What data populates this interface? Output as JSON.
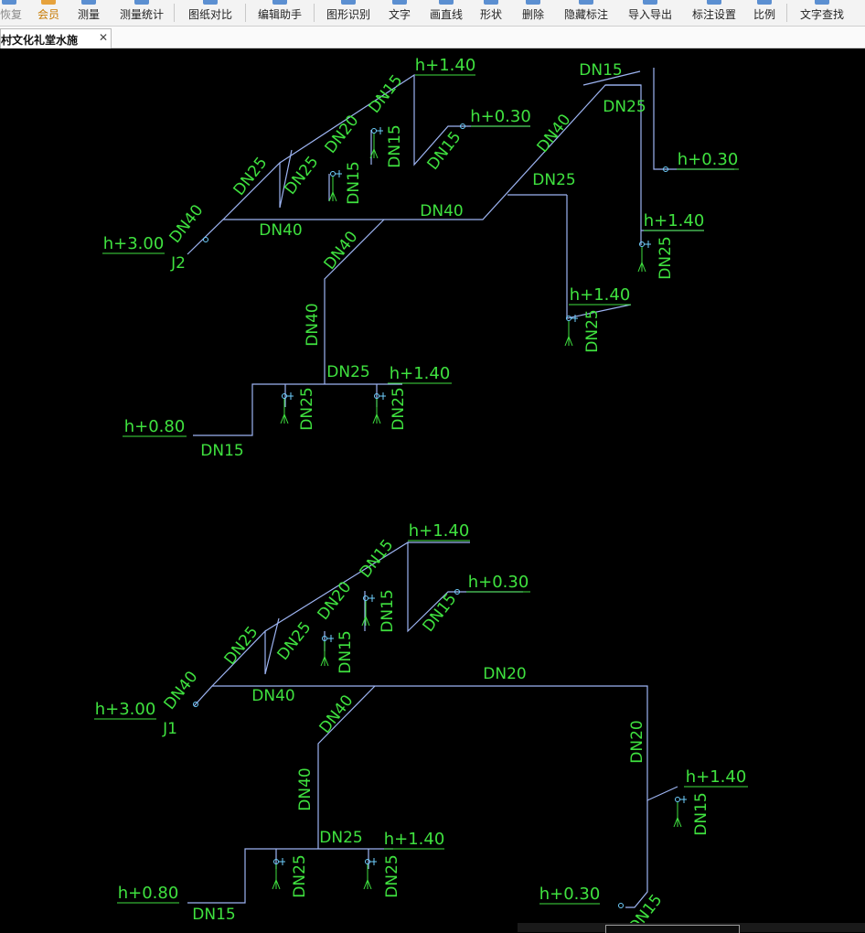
{
  "toolbar": {
    "items": [
      {
        "label": "恢复",
        "icon": "restore-icon",
        "enabled": false
      },
      {
        "label": "会员",
        "icon": "member-icon",
        "enabled": true
      },
      {
        "label": "测量",
        "icon": "measure-icon",
        "enabled": true
      },
      {
        "label": "测量统计",
        "icon": "measure-stats-icon",
        "enabled": true
      },
      {
        "label": "图纸对比",
        "icon": "compare-icon",
        "enabled": true
      },
      {
        "label": "编辑助手",
        "icon": "edit-assistant-icon",
        "enabled": true
      },
      {
        "label": "图形识别",
        "icon": "shape-recognition-icon",
        "enabled": true
      },
      {
        "label": "文字",
        "icon": "text-icon",
        "enabled": true
      },
      {
        "label": "画直线",
        "icon": "line-icon",
        "enabled": true
      },
      {
        "label": "形状",
        "icon": "shape-icon",
        "enabled": true
      },
      {
        "label": "删除",
        "icon": "delete-icon",
        "enabled": true
      },
      {
        "label": "隐藏标注",
        "icon": "hide-annotation-icon",
        "enabled": true
      },
      {
        "label": "导入导出",
        "icon": "import-export-icon",
        "enabled": true
      },
      {
        "label": "标注设置",
        "icon": "annotation-settings-icon",
        "enabled": true
      },
      {
        "label": "比例",
        "icon": "scale-icon",
        "enabled": true
      },
      {
        "label": "文字查找",
        "icon": "text-search-icon",
        "enabled": true
      }
    ]
  },
  "tab": {
    "title": "村文化礼堂水施",
    "close_symbol": "✕"
  },
  "colors": {
    "pipe": "#9db4f2",
    "text": "#3fe13f",
    "fixture": "#6fd0ff",
    "background": "#000000"
  },
  "drawing": {
    "j2": {
      "riser_label": "J2",
      "elevations": [
        "h+3.00",
        "h+1.40",
        "h+0.30",
        "h+0.30",
        "h+1.40",
        "h+1.40",
        "h+0.80",
        "h+1.40"
      ],
      "pipe_sizes": [
        "DN40",
        "DN25",
        "DN25",
        "DN20",
        "DN15",
        "DN15",
        "DN15",
        "DN15",
        "DN40",
        "DN40",
        "DN40",
        "DN15",
        "DN25",
        "DN40",
        "DN25",
        "DN25",
        "DN25",
        "DN40",
        "DN25",
        "DN25",
        "DN25",
        "DN15"
      ]
    },
    "j1": {
      "riser_label": "J1",
      "elevations": [
        "h+3.00",
        "h+1.40",
        "h+0.30",
        "h+1.40",
        "h+0.80",
        "h+1.40",
        "h+0.30"
      ],
      "pipe_sizes": [
        "DN40",
        "DN25",
        "DN25",
        "DN20",
        "DN15",
        "DN15",
        "DN15",
        "DN15",
        "DN40",
        "DN20",
        "DN40",
        "DN20",
        "DN15",
        "DN40",
        "DN25",
        "DN25",
        "DN25",
        "DN15",
        "DN15"
      ]
    }
  }
}
